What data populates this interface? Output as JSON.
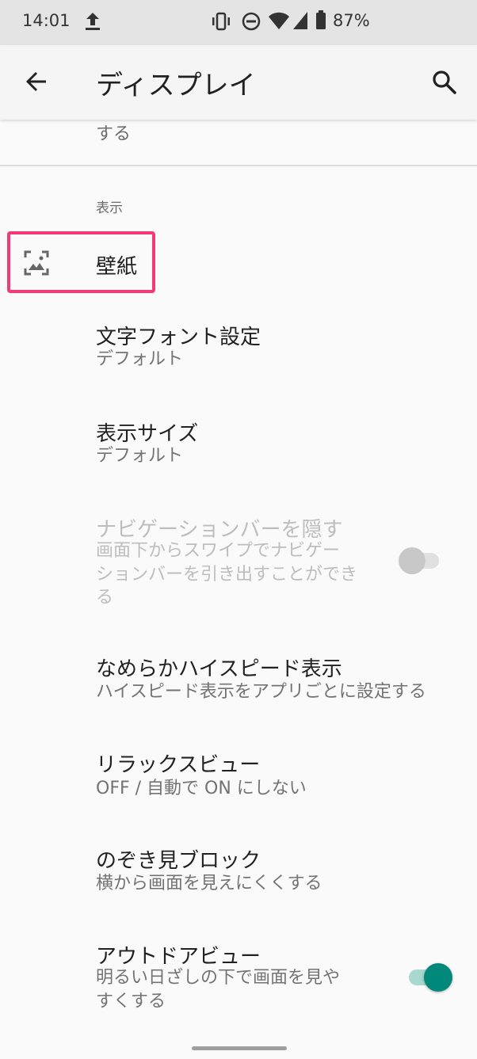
{
  "status": {
    "time": "14:01",
    "battery": "87%"
  },
  "appbar": {
    "title": "ディスプレイ"
  },
  "top_cut_text": "する",
  "section": {
    "header": "表示"
  },
  "items": [
    {
      "title": "壁紙"
    },
    {
      "title": "文字フォント設定",
      "subtitle": "デフォルト"
    },
    {
      "title": "表示サイズ",
      "subtitle": "デフォルト"
    },
    {
      "title": "ナビゲーションバーを隠す",
      "subtitle_lines": [
        "画面下からスワイプでナビゲー",
        "ションバーを引き出すことができ",
        "る"
      ],
      "toggle": "off",
      "disabled": true
    },
    {
      "title": "なめらかハイスピード表示",
      "subtitle": "ハイスピード表示をアプリごとに設定する"
    },
    {
      "title": "リラックスビュー",
      "subtitle": "OFF / 自動で ON にしない"
    },
    {
      "title": "のぞき見ブロック",
      "subtitle": "横から画面を見えにくくする"
    },
    {
      "title": "アウトドアビュー",
      "subtitle_lines": [
        "明るい日ざしの下で画面を見や",
        "すくする"
      ],
      "toggle": "on"
    }
  ],
  "colors": {
    "highlight": "#f23a7b",
    "accent": "#00897b"
  }
}
